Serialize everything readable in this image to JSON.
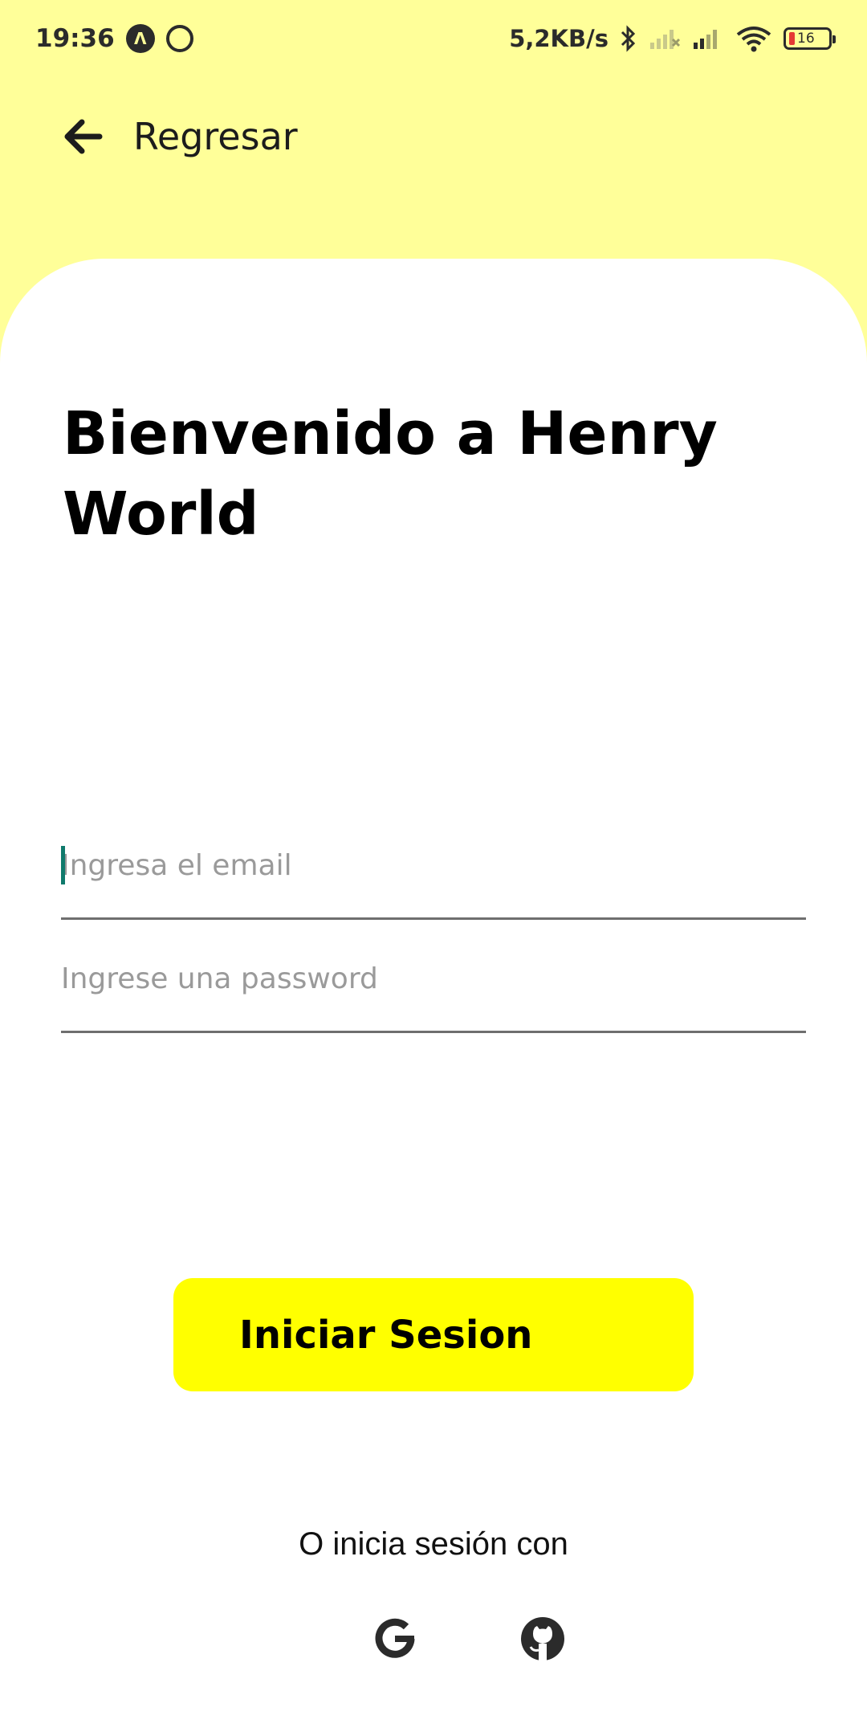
{
  "status_bar": {
    "time": "19:36",
    "network_speed": "5,2KB/s",
    "battery_level": "16",
    "icons": [
      "app-notification-icon",
      "whatsapp-icon",
      "bluetooth-icon",
      "signal-icon",
      "signal-icon",
      "wifi-icon",
      "battery-icon"
    ]
  },
  "header": {
    "back_label": "Regresar",
    "background_color": "#ffff99"
  },
  "main": {
    "title": "Bienvenido a Henry World",
    "email_placeholder": "Ingresa el email",
    "email_value": "",
    "password_placeholder": "Ingrese una password",
    "password_value": "",
    "login_button_label": "Iniciar Sesion",
    "login_button_color": "#ffff00",
    "alt_login_text": "O inicia sesión con",
    "social_providers": [
      "google-icon",
      "github-icon"
    ]
  }
}
